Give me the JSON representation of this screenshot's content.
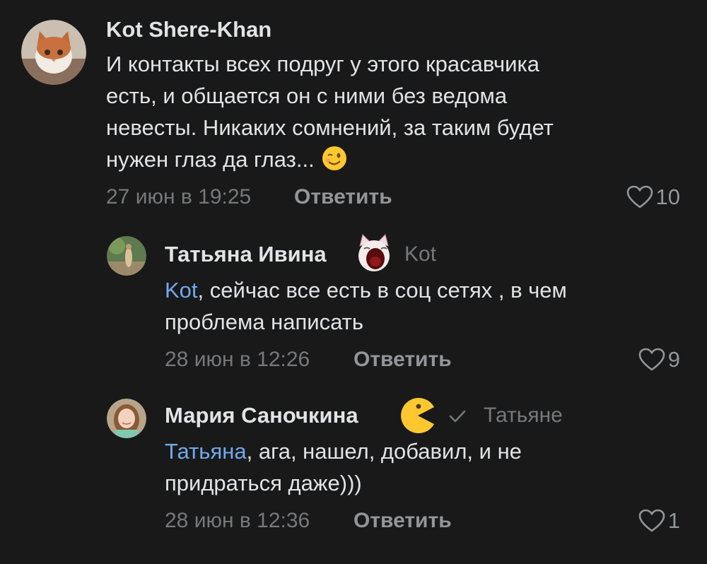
{
  "comments": [
    {
      "author": "Kot Shere-Khan",
      "text_lines": [
        "И контакты всех подруг у этого красавчика",
        "есть, и общается он с ними без ведома",
        "невесты. Никаких сомнений, за таким будет",
        "нужен глаз да глаз..."
      ],
      "emoji": "winking-face",
      "date": "27 июн в 19:25",
      "reply_label": "Ответить",
      "likes": "10"
    },
    {
      "author": "Татьяна Ивина",
      "sticker": "screaming-cat-sticker",
      "reply_to": "Kot",
      "mention": "Kot",
      "text_line1_rest": ", сейчас все есть в соц сетях , в чем",
      "text_line2": "проблема написать",
      "date": "28 июн в 12:26",
      "reply_label": "Ответить",
      "likes": "9"
    },
    {
      "author": "Мария Саночкина",
      "sticker": "pacman-emoji",
      "reply_to": "Татьяне",
      "mention": "Татьяна",
      "text_line1_rest": ", ага, нашел, добавил, и не",
      "text_line2": "придраться даже)))",
      "date": "28 июн в 12:36",
      "reply_label": "Ответить",
      "likes": "1"
    }
  ],
  "colors": {
    "background": "#19191a",
    "text": "#e1e3e6",
    "mention": "#71aaeb",
    "meta": "#76787a"
  }
}
